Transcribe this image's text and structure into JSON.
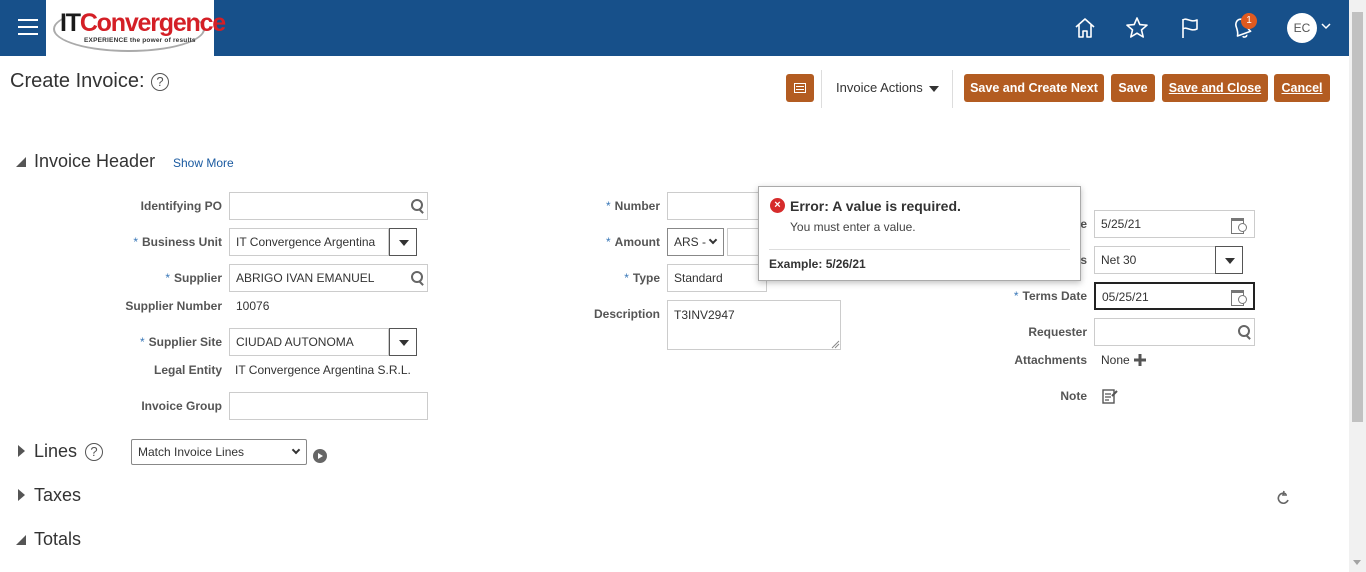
{
  "header": {
    "logo_it": "IT",
    "logo_convergence": "Convergence",
    "logo_tagline": "EXPERIENCE the power of results",
    "notification_count": "1",
    "avatar_initials": "EC"
  },
  "page": {
    "title": "Create Invoice:",
    "help_glyph": "?"
  },
  "toolbar": {
    "invoice_actions": "Invoice Actions",
    "save_create_next": "Save and Create Next",
    "save": "Save",
    "save_close_u": "S",
    "save_close_rest": "ave and Close",
    "cancel_u": "C",
    "cancel_rest": "ancel"
  },
  "invoice_header": {
    "title": "Invoice Header",
    "show_more": "Show More",
    "identifying_po_label": "Identifying PO",
    "identifying_po_value": "",
    "business_unit_label": "Business Unit",
    "business_unit_value": "IT Convergence Argentina",
    "supplier_label": "Supplier",
    "supplier_value": "ABRIGO IVAN EMANUEL",
    "supplier_number_label": "Supplier Number",
    "supplier_number_value": "10076",
    "supplier_site_label": "Supplier Site",
    "supplier_site_value": "CIUDAD AUTONOMA",
    "legal_entity_label": "Legal Entity",
    "legal_entity_value": "IT Convergence Argentina S.R.L.",
    "invoice_group_label": "Invoice Group",
    "invoice_group_value": "",
    "number_label": "Number",
    "number_value": "",
    "amount_label": "Amount",
    "currency_value": "ARS -",
    "amount_value": "",
    "type_label": "Type",
    "type_value": "Standard",
    "description_label": "Description",
    "description_value": "T3INV2947",
    "date_label_tail": "e",
    "date_value": "5/25/21",
    "payment_terms_label_tail": "s",
    "payment_terms_value": "Net 30",
    "terms_date_label": "Terms Date",
    "terms_date_value": "05/25/21",
    "requester_label": "Requester",
    "requester_value": "",
    "attachments_label": "Attachments",
    "attachments_value": "None",
    "note_label": "Note",
    "required_marker": "*"
  },
  "error_popup": {
    "title": "Error: A value is required.",
    "message": "You must enter a value.",
    "example": "Example: 5/26/21"
  },
  "lines": {
    "title": "Lines",
    "match_select_value": "Match Invoice Lines"
  },
  "taxes": {
    "title": "Taxes"
  },
  "totals": {
    "title": "Totals"
  },
  "colors": {
    "topbar": "#17508a",
    "button": "#b35c21",
    "error": "#d62c2c",
    "link": "#1a5aa0"
  }
}
